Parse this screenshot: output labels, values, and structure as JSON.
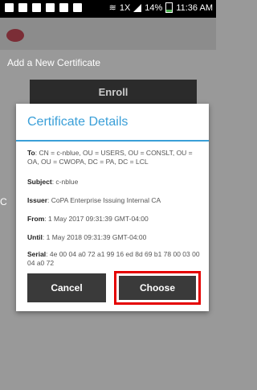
{
  "status_bar": {
    "battery": "14%",
    "time": "11:36 AM",
    "signal_label": "1X"
  },
  "screen": {
    "section_label": "Add a New Certificate",
    "enroll_label": "Enroll",
    "partial_label": "C"
  },
  "dialog": {
    "title": "Certificate Details",
    "to_label": "To",
    "to_value": ": CN = c-nblue, OU = USERS, OU = CONSLT, OU = OA, OU = CWOPA, DC = PA, DC = LCL",
    "subject_label": "Subject",
    "subject_value": ": c-nblue",
    "issuer_label": "Issuer",
    "issuer_value": ": CoPA Enterprise Issuing Internal CA",
    "from_label": "From",
    "from_value": ": 1 May 2017 09:31:39 GMT-04:00",
    "until_label": "Until",
    "until_value": ": 1 May 2018 09:31:39 GMT-04:00",
    "serial_label": "Serial",
    "serial_value": ": 4e 00 04 a0 72 a1 99 16 ed 8d 69 b1 78 00 03 00 04 a0 72",
    "cancel_label": "Cancel",
    "choose_label": "Choose"
  },
  "colors": {
    "accent": "#3a9fd8",
    "highlight": "#e50000"
  }
}
